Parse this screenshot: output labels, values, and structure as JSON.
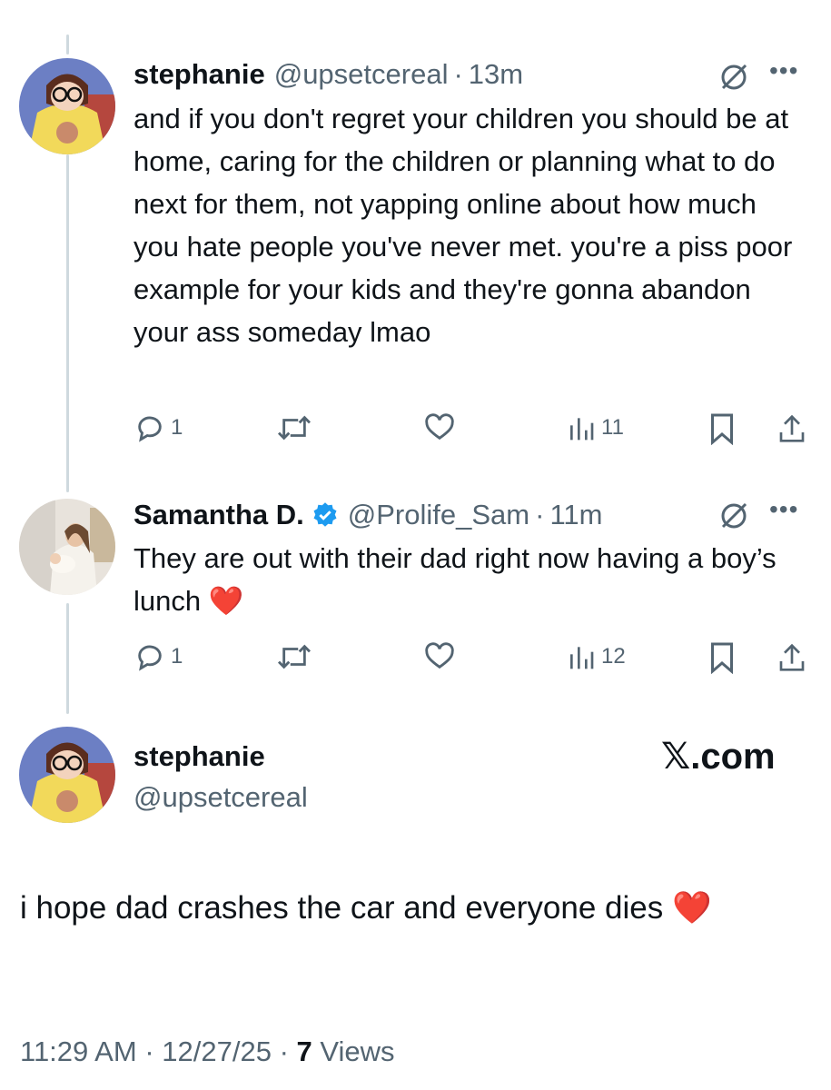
{
  "tweet1": {
    "name": "stephanie",
    "handle": "@upsetcereal",
    "separator": "·",
    "time": "13m",
    "text": "and if you don't regret your children you should be at home, caring for the children or planning what to do next for them, not yapping online about how much you hate people you've never met. you're a piss poor example for your kids and they're gonna abandon your ass someday lmao",
    "replies": "1",
    "views": "11"
  },
  "tweet2": {
    "name": "Samantha D.",
    "handle": "@Prolife_Sam",
    "separator": "·",
    "time": "11m",
    "text": "They are out with their dad right now having a boy’s lunch ❤️",
    "replies": "1",
    "views": "12"
  },
  "main_tweet": {
    "name": "stephanie",
    "handle": "@upsetcereal",
    "watermark": "𝕏.com",
    "text": "i hope dad crashes the car and everyone dies ❤️",
    "time": "11:29 AM",
    "separator": "·",
    "date": "12/27/25",
    "views_count": "7",
    "views_label": "Views"
  },
  "icons": {
    "reply": "reply-icon",
    "repost": "repost-icon",
    "like": "heart-icon",
    "views": "analytics-icon",
    "bookmark": "bookmark-icon",
    "share": "share-icon",
    "grok": "grok-icon",
    "more": "more-icon",
    "verified": "verified-badge-icon"
  },
  "colors": {
    "accent": "#1d9bf0",
    "secondary_text": "#536471",
    "thread_line": "#cfd9de"
  }
}
